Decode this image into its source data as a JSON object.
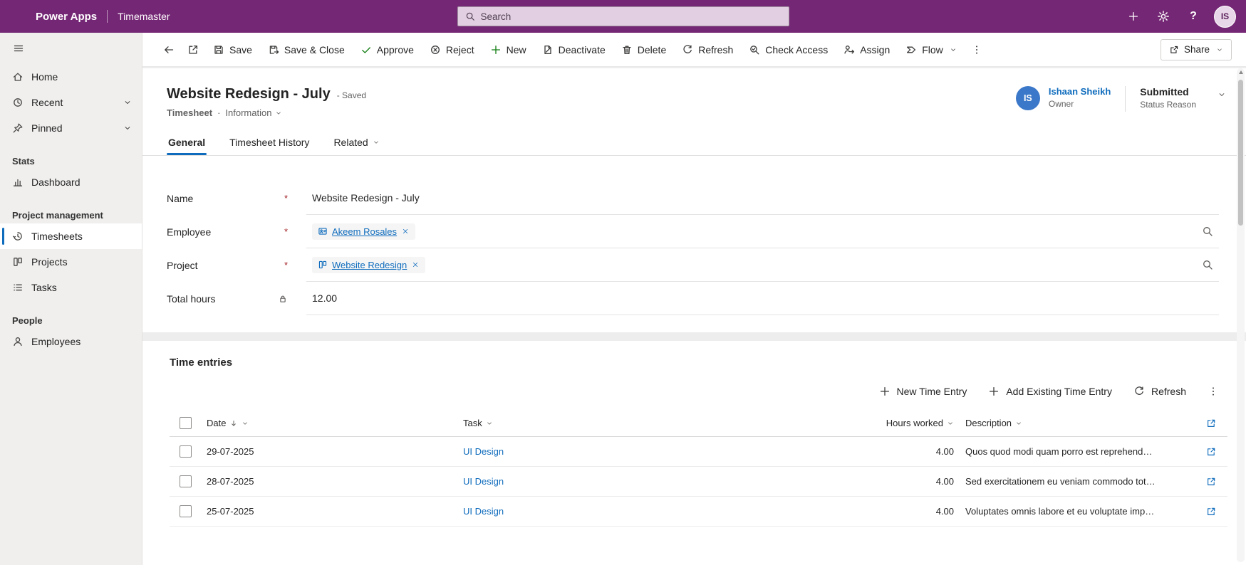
{
  "colors": {
    "topbar_bg": "#742774",
    "link_blue": "#0f6cbd",
    "approve_green": "#107c10",
    "owner_avatar_bg": "#3b78c9",
    "required_red": "#a4262c"
  },
  "icons": {
    "help": "?"
  },
  "topbar": {
    "brand": "Power Apps",
    "app_name": "Timemaster",
    "search_placeholder": "Search",
    "avatar_initials": "IS"
  },
  "sidebar": {
    "home": "Home",
    "recent": "Recent",
    "pinned": "Pinned",
    "group_stats": "Stats",
    "dashboard": "Dashboard",
    "group_project_management": "Project management",
    "timesheets": "Timesheets",
    "projects": "Projects",
    "tasks": "Tasks",
    "group_people": "People",
    "employees": "Employees"
  },
  "command_bar": {
    "save": "Save",
    "save_close": "Save & Close",
    "approve": "Approve",
    "reject": "Reject",
    "new": "New",
    "deactivate": "Deactivate",
    "delete": "Delete",
    "refresh": "Refresh",
    "check_access": "Check Access",
    "assign": "Assign",
    "flow": "Flow",
    "share": "Share"
  },
  "form": {
    "title": "Website Redesign - July",
    "save_state": "- Saved",
    "entity": "Timesheet",
    "separator": "·",
    "form_name": "Information",
    "required_marker": "*",
    "tabs": {
      "general": "General",
      "history": "Timesheet History",
      "related": "Related"
    },
    "owner": {
      "initials": "IS",
      "name": "Ishaan Sheikh",
      "role": "Owner"
    },
    "status": {
      "value": "Submitted",
      "label": "Status Reason"
    },
    "fields": {
      "name": {
        "label": "Name",
        "value": "Website Redesign - July"
      },
      "employee": {
        "label": "Employee",
        "value": "Akeem Rosales"
      },
      "project": {
        "label": "Project",
        "value": "Website Redesign"
      },
      "total_hours": {
        "label": "Total hours",
        "value": "12.00"
      }
    }
  },
  "time_entries": {
    "title": "Time entries",
    "toolbar": {
      "new_time_entry": "New Time Entry",
      "add_existing": "Add Existing Time Entry",
      "refresh": "Refresh"
    },
    "columns": {
      "date": "Date",
      "task": "Task",
      "hours": "Hours worked",
      "description": "Description"
    },
    "rows": [
      {
        "date": "29-07-2025",
        "task": "UI Design",
        "hours": "4.00",
        "description": "Quos quod modi quam porro est reprehend…"
      },
      {
        "date": "28-07-2025",
        "task": "UI Design",
        "hours": "4.00",
        "description": "Sed exercitationem eu veniam commodo tot…"
      },
      {
        "date": "25-07-2025",
        "task": "UI Design",
        "hours": "4.00",
        "description": "Voluptates omnis labore et eu voluptate imp…"
      }
    ]
  }
}
